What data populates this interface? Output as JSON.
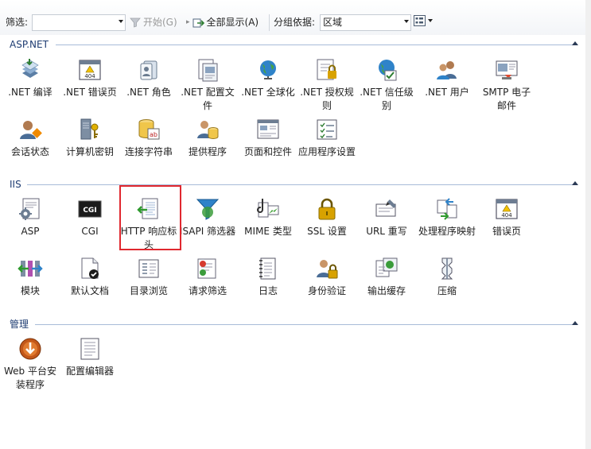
{
  "toolbar": {
    "filter_label": "筛选:",
    "filter_value": "",
    "start_label": "开始(G)",
    "show_all_label": "全部显示(A)",
    "group_by_label": "分组依据:",
    "group_by_value": "区域"
  },
  "sections": [
    {
      "title": "ASP.NET",
      "items": [
        {
          "label": ".NET 编译",
          "icon": "compile-icon"
        },
        {
          "label": ".NET 错误页",
          "icon": "error-404-icon"
        },
        {
          "label": ".NET 角色",
          "icon": "roles-icon"
        },
        {
          "label": ".NET 配置文件",
          "icon": "profile-icon"
        },
        {
          "label": ".NET 全球化",
          "icon": "globe-icon"
        },
        {
          "label": ".NET 授权规则",
          "icon": "auth-rules-icon"
        },
        {
          "label": ".NET 信任级别",
          "icon": "trust-level-icon"
        },
        {
          "label": ".NET 用户",
          "icon": "users-icon"
        },
        {
          "label": "SMTP 电子邮件",
          "icon": "smtp-icon"
        },
        {
          "label": "会话状态",
          "icon": "session-icon"
        },
        {
          "label": "计算机密钥",
          "icon": "machine-key-icon"
        },
        {
          "label": "连接字符串",
          "icon": "connection-string-icon"
        },
        {
          "label": "提供程序",
          "icon": "providers-icon"
        },
        {
          "label": "页面和控件",
          "icon": "pages-controls-icon"
        },
        {
          "label": "应用程序设置",
          "icon": "app-settings-icon"
        }
      ]
    },
    {
      "title": "IIS",
      "items": [
        {
          "label": "ASP",
          "icon": "asp-icon"
        },
        {
          "label": "CGI",
          "icon": "cgi-icon"
        },
        {
          "label": "HTTP 响应标头",
          "icon": "http-headers-icon"
        },
        {
          "label": "ISAPI 筛选器",
          "icon": "isapi-filter-icon"
        },
        {
          "label": "MIME 类型",
          "icon": "mime-icon"
        },
        {
          "label": "SSL 设置",
          "icon": "lock-icon"
        },
        {
          "label": "URL 重写",
          "icon": "url-rewrite-icon"
        },
        {
          "label": "处理程序映射",
          "icon": "handler-mapping-icon"
        },
        {
          "label": "错误页",
          "icon": "error-page-icon"
        },
        {
          "label": "模块",
          "icon": "modules-icon"
        },
        {
          "label": "默认文档",
          "icon": "default-document-icon"
        },
        {
          "label": "目录浏览",
          "icon": "directory-browsing-icon"
        },
        {
          "label": "请求筛选",
          "icon": "request-filtering-icon"
        },
        {
          "label": "日志",
          "icon": "logging-icon"
        },
        {
          "label": "身份验证",
          "icon": "authentication-icon"
        },
        {
          "label": "输出缓存",
          "icon": "output-cache-icon"
        },
        {
          "label": "压缩",
          "icon": "compression-icon"
        }
      ]
    },
    {
      "title": "管理",
      "items": [
        {
          "label": "Web 平台安装程序",
          "icon": "web-platform-installer-icon"
        },
        {
          "label": "配置编辑器",
          "icon": "config-editor-icon"
        }
      ]
    }
  ]
}
